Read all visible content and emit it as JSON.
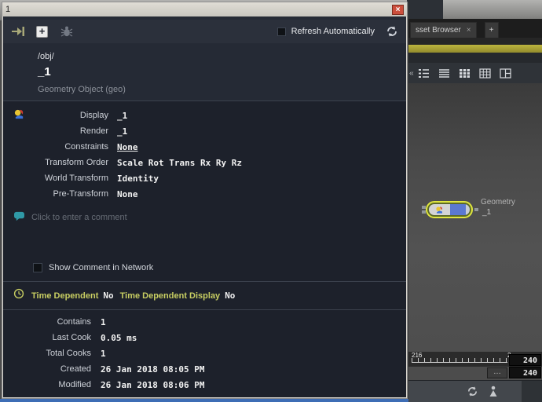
{
  "popup": {
    "titlebar": {
      "title": "1",
      "close_glyph": "×"
    },
    "toolbar": {
      "plus_glyph": "+",
      "refresh_checkbox_label": "Refresh Automatically"
    },
    "header": {
      "path": "/obj/",
      "name": "_1",
      "subtitle": "Geometry Object (geo)"
    },
    "info": {
      "rows": [
        {
          "label": "Display",
          "value": "_1"
        },
        {
          "label": "Render",
          "value": "_1"
        },
        {
          "label": "Constraints",
          "value": "None"
        },
        {
          "label": "Transform Order",
          "value": "Scale Rot Trans Rx Ry Rz"
        },
        {
          "label": "World Transform",
          "value": "Identity"
        },
        {
          "label": "Pre-Transform",
          "value": "None"
        }
      ]
    },
    "comment": {
      "placeholder": "Click to enter a comment",
      "show_checkbox_label": "Show Comment in Network"
    },
    "time": {
      "label1": "Time Dependent",
      "value1": "No",
      "label2": "Time Dependent Display",
      "value2": "No"
    },
    "stats": {
      "rows": [
        {
          "label": "Contains",
          "value": "1"
        },
        {
          "label": "Last Cook",
          "value": "0.05 ms"
        },
        {
          "label": "Total Cooks",
          "value": "1"
        },
        {
          "label": "Created",
          "value": "26 Jan 2018 08:05 PM"
        },
        {
          "label": "Modified",
          "value": "26 Jan 2018 08:06 PM"
        }
      ]
    }
  },
  "background": {
    "tabbar": {
      "tab_label": "sset Browser",
      "tab_close_glyph": "×",
      "add_tab_glyph": "+"
    },
    "iconrow": {
      "back_glyph": "‹‹"
    },
    "node": {
      "type_label": "Geometry",
      "name": "_1"
    },
    "timeline": {
      "start_label": "216",
      "end_label": "2"
    },
    "fields": {
      "top_value": "240",
      "bottom_value": "240",
      "overflow_glyph": "…"
    }
  }
}
